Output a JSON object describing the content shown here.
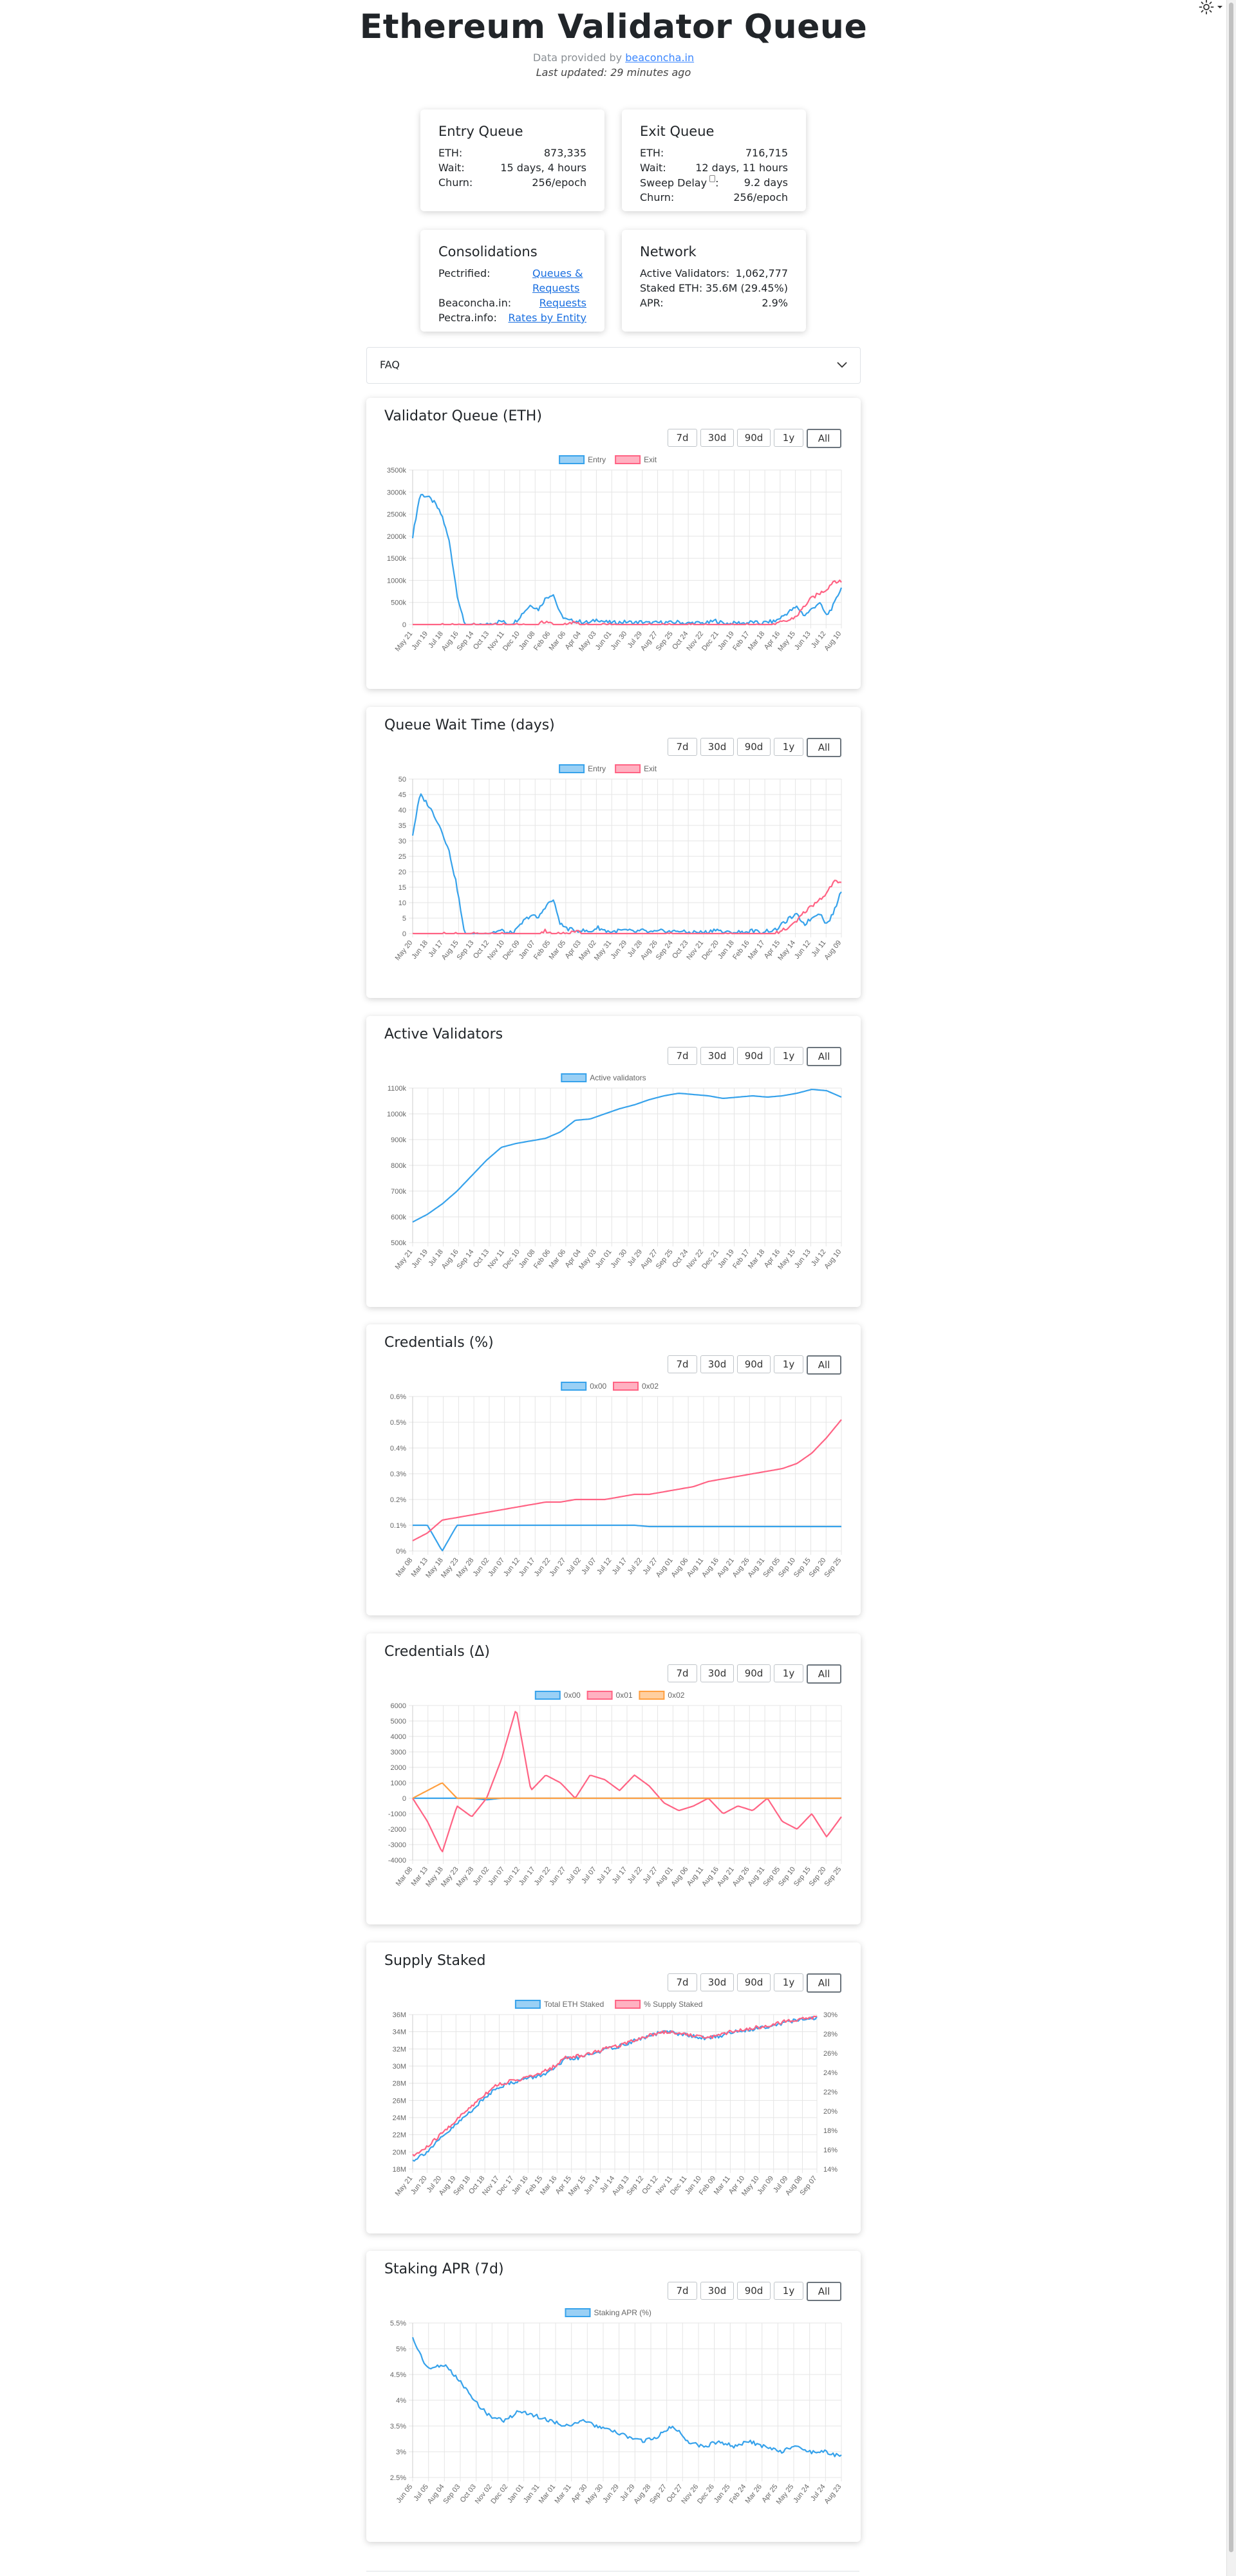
{
  "page": {
    "title": "Ethereum Validator Queue",
    "provided_prefix": "Data provided by",
    "provided_link": "beaconcha.in",
    "last_updated": "Last updated: 29 minutes ago"
  },
  "entry": {
    "title": "Entry Queue",
    "rows": [
      {
        "label": "ETH:",
        "value": "873,335"
      },
      {
        "label": "Wait:",
        "value": "15 days, 4 hours"
      },
      {
        "label": "Churn:",
        "value": "256/epoch"
      }
    ]
  },
  "exit": {
    "title": "Exit Queue",
    "rows": [
      {
        "label": "ETH:",
        "value": "716,715"
      },
      {
        "label": "Wait:",
        "value": "12 days, 11 hours"
      },
      {
        "label": "Sweep Delay",
        "value": "9.2 days"
      },
      {
        "label": "Churn:",
        "value": "256/epoch"
      }
    ]
  },
  "consolidations": {
    "title": "Consolidations",
    "rows": [
      {
        "label": "Pectrified:",
        "link": "Queues & Requests"
      },
      {
        "label": "Beaconcha.in:",
        "link": "Requests"
      },
      {
        "label": "Pectra.info:",
        "link": "Rates by Entity"
      }
    ]
  },
  "network": {
    "title": "Network",
    "rows": [
      {
        "label": "Active Validators:",
        "value": "1,062,777"
      },
      {
        "label": "Staked ETH:",
        "value": "35.6M (29.45%)"
      },
      {
        "label": "APR:",
        "value": "2.9%"
      }
    ]
  },
  "faq": {
    "label": "FAQ"
  },
  "range_buttons": [
    "7d",
    "30d",
    "90d",
    "1y",
    "All"
  ],
  "active_range": "All",
  "colors": {
    "blue": "#36a2eb",
    "red": "#ff6384",
    "orange": "#ff9f40",
    "grid": "#e5e5e5",
    "tick": "#666666"
  },
  "chart_data": [
    {
      "id": "queue-eth",
      "type": "line",
      "title": "Validator Queue (ETH)",
      "x": [
        "May 21",
        "Jun 19",
        "Jul 18",
        "Aug 16",
        "Sep 14",
        "Oct 13",
        "Nov 11",
        "Dec 10",
        "Jan 08",
        "Feb 06",
        "Mar 06",
        "Apr 04",
        "May 03",
        "Jun 01",
        "Jun 30",
        "Jul 29",
        "Aug 27",
        "Sep 25",
        "Oct 24",
        "Nov 22",
        "Dec 21",
        "Jan 19",
        "Feb 17",
        "Mar 18",
        "Apr 16",
        "May 15",
        "Jun 13",
        "Jul 12",
        "Aug 10"
      ],
      "yticks": [
        "3500k",
        "3000k",
        "2500k",
        "2000k",
        "1500k",
        "1000k",
        "500k",
        "0"
      ],
      "ylim": [
        0,
        3500000
      ],
      "series": [
        {
          "name": "Entry",
          "color": "blue",
          "values": [
            2000000,
            2950000,
            2900000,
            2750000,
            2450000,
            1850000,
            700000,
            0,
            0,
            0,
            0,
            40000,
            80000,
            0,
            80000,
            280000,
            450000,
            340000,
            600000,
            700000,
            220000,
            90000,
            80000,
            60000,
            40000,
            120000,
            60000,
            40000,
            50000,
            60000,
            40000,
            60000,
            30000,
            40000,
            50000,
            40000,
            60000,
            20000,
            40000,
            30000,
            40000,
            90000,
            30000,
            20000,
            40000,
            30000,
            60000,
            20000,
            60000,
            70000,
            180000,
            300000,
            400000,
            200000,
            350000,
            500000,
            200000,
            450000,
            850000
          ]
        },
        {
          "name": "Exit",
          "color": "red",
          "values": [
            0,
            0,
            0,
            0,
            0,
            0,
            0,
            0,
            0,
            0,
            0,
            0,
            0,
            0,
            0,
            0,
            0,
            0,
            80000,
            0,
            0,
            0,
            60000,
            0,
            0,
            0,
            0,
            0,
            0,
            0,
            0,
            0,
            0,
            0,
            0,
            0,
            0,
            0,
            0,
            0,
            0,
            0,
            0,
            0,
            0,
            0,
            0,
            0,
            0,
            0,
            50000,
            100000,
            200000,
            420000,
            600000,
            700000,
            800000,
            1000000,
            950000
          ]
        }
      ]
    },
    {
      "id": "wait-days",
      "type": "line",
      "title": "Queue Wait Time (days)",
      "x": [
        "May 20",
        "Jun 18",
        "Jul 17",
        "Aug 15",
        "Sep 13",
        "Oct 12",
        "Nov 10",
        "Dec 09",
        "Jan 07",
        "Feb 05",
        "Mar 05",
        "Apr 03",
        "May 02",
        "May 31",
        "Jun 29",
        "Jul 28",
        "Aug 26",
        "Sep 24",
        "Oct 23",
        "Nov 21",
        "Dec 20",
        "Jan 18",
        "Feb 16",
        "Mar 17",
        "Apr 15",
        "May 14",
        "Jun 12",
        "Jul 11",
        "Aug 09"
      ],
      "yticks": [
        "50",
        "45",
        "40",
        "35",
        "30",
        "25",
        "20",
        "15",
        "10",
        "5",
        "0"
      ],
      "ylim": [
        0,
        50
      ],
      "series": [
        {
          "name": "Entry",
          "color": "blue",
          "values": [
            32,
            45,
            42,
            38,
            33,
            26,
            15,
            0,
            0,
            0,
            0,
            0.5,
            1,
            0,
            1,
            4,
            6,
            5,
            9,
            11,
            3,
            1.5,
            1,
            1,
            0.5,
            2,
            1,
            0.5,
            1,
            1,
            0.5,
            1,
            0.4,
            0.5,
            1,
            0.5,
            1,
            0.3,
            0.5,
            0.4,
            0.5,
            1.5,
            0.4,
            0.3,
            0.5,
            0.4,
            1,
            0.3,
            1,
            1,
            3,
            5,
            6,
            3,
            5,
            7,
            3,
            7,
            14
          ]
        },
        {
          "name": "Exit",
          "color": "red",
          "values": [
            0,
            0,
            0,
            0,
            0,
            0,
            0,
            0,
            0,
            0,
            0,
            0,
            0,
            0,
            0,
            0,
            0,
            0,
            1,
            0,
            0,
            0,
            1,
            0,
            0,
            0,
            0,
            0,
            0,
            0,
            0,
            0,
            0,
            0,
            0,
            0,
            0,
            0,
            0,
            0,
            0,
            0,
            0,
            0,
            0,
            0,
            0,
            0,
            0,
            0,
            1,
            2,
            4,
            7,
            9,
            11,
            13,
            17,
            16
          ]
        }
      ]
    },
    {
      "id": "active-validators",
      "type": "line",
      "title": "Active Validators",
      "x": [
        "May 21",
        "Jun 19",
        "Jul 18",
        "Aug 16",
        "Sep 14",
        "Oct 13",
        "Nov 11",
        "Dec 10",
        "Jan 08",
        "Feb 06",
        "Mar 06",
        "Apr 04",
        "May 03",
        "Jun 01",
        "Jun 30",
        "Jul 29",
        "Aug 27",
        "Sep 25",
        "Oct 24",
        "Nov 22",
        "Dec 21",
        "Jan 19",
        "Feb 17",
        "Mar 18",
        "Apr 16",
        "May 15",
        "Jun 13",
        "Jul 12",
        "Aug 10"
      ],
      "yticks": [
        "1100k",
        "1000k",
        "900k",
        "800k",
        "700k",
        "600k",
        "500k"
      ],
      "ylim": [
        500000,
        1100000
      ],
      "series": [
        {
          "name": "Active validators",
          "color": "blue",
          "values": [
            580000,
            610000,
            650000,
            700000,
            760000,
            820000,
            870000,
            885000,
            895000,
            905000,
            930000,
            975000,
            980000,
            1000000,
            1020000,
            1035000,
            1055000,
            1070000,
            1080000,
            1075000,
            1070000,
            1060000,
            1065000,
            1070000,
            1065000,
            1070000,
            1080000,
            1095000,
            1090000,
            1065000
          ]
        }
      ]
    },
    {
      "id": "credentials-pct",
      "type": "line",
      "title": "Credentials (%)",
      "x": [
        "Mar 08",
        "Mar 13",
        "May 18",
        "May 23",
        "May 28",
        "Jun 02",
        "Jun 07",
        "Jun 12",
        "Jun 17",
        "Jun 22",
        "Jun 27",
        "Jul 02",
        "Jul 07",
        "Jul 12",
        "Jul 17",
        "Jul 22",
        "Jul 27",
        "Aug 01",
        "Aug 06",
        "Aug 11",
        "Aug 16",
        "Aug 21",
        "Aug 26",
        "Aug 31",
        "Sep 05",
        "Sep 10",
        "Sep 15",
        "Sep 20",
        "Sep 25"
      ],
      "yticks": [
        "0.6%",
        "0.5%",
        "0.4%",
        "0.3%",
        "0.2%",
        "0.1%",
        "0%"
      ],
      "ylim": [
        0,
        0.6
      ],
      "series": [
        {
          "name": "0x00",
          "color": "blue",
          "values": [
            0.1,
            0.1,
            0.0,
            0.1,
            0.1,
            0.1,
            0.1,
            0.1,
            0.1,
            0.1,
            0.1,
            0.1,
            0.1,
            0.1,
            0.1,
            0.1,
            0.095,
            0.095,
            0.095,
            0.095,
            0.095,
            0.095,
            0.095,
            0.095,
            0.095,
            0.095,
            0.095,
            0.095,
            0.095,
            0.095
          ]
        },
        {
          "name": "0x02",
          "color": "red",
          "values": [
            0.04,
            0.07,
            0.12,
            0.13,
            0.14,
            0.15,
            0.16,
            0.17,
            0.18,
            0.19,
            0.19,
            0.2,
            0.2,
            0.2,
            0.21,
            0.22,
            0.22,
            0.23,
            0.24,
            0.25,
            0.27,
            0.28,
            0.29,
            0.3,
            0.31,
            0.32,
            0.34,
            0.38,
            0.44,
            0.51
          ]
        }
      ]
    },
    {
      "id": "credentials-delta",
      "type": "line",
      "title": "Credentials (Δ)",
      "x": [
        "Mar 08",
        "Mar 13",
        "May 18",
        "May 23",
        "May 28",
        "Jun 02",
        "Jun 07",
        "Jun 12",
        "Jun 17",
        "Jun 22",
        "Jun 27",
        "Jul 02",
        "Jul 07",
        "Jul 12",
        "Jul 17",
        "Jul 22",
        "Jul 27",
        "Aug 01",
        "Aug 06",
        "Aug 11",
        "Aug 16",
        "Aug 21",
        "Aug 26",
        "Aug 31",
        "Sep 05",
        "Sep 10",
        "Sep 15",
        "Sep 20",
        "Sep 25"
      ],
      "yticks": [
        "6000",
        "5000",
        "4000",
        "3000",
        "2000",
        "1000",
        "0",
        "-1000",
        "-2000",
        "-3000",
        "-4000"
      ],
      "ylim": [
        -4000,
        6000
      ],
      "series": [
        {
          "name": "0x00",
          "color": "blue",
          "values": [
            0,
            0,
            0,
            0,
            0,
            -100,
            0,
            0,
            0,
            0,
            0,
            0,
            0,
            0,
            0,
            0,
            0,
            0,
            0,
            0,
            0,
            0,
            0,
            0,
            0,
            0,
            0,
            0,
            0,
            0
          ]
        },
        {
          "name": "0x01",
          "color": "red",
          "values": [
            0,
            -1500,
            -3500,
            -500,
            -1200,
            0,
            2500,
            5800,
            500,
            1500,
            1000,
            0,
            1500,
            1200,
            500,
            1500,
            800,
            -300,
            -800,
            -500,
            0,
            -1000,
            -500,
            -800,
            0,
            -1500,
            -2000,
            -1000,
            -2500,
            -1200
          ]
        },
        {
          "name": "0x02",
          "color": "orange",
          "values": [
            0,
            500,
            1000,
            0,
            0,
            0,
            0,
            0,
            0,
            0,
            0,
            0,
            0,
            0,
            0,
            0,
            0,
            0,
            0,
            0,
            0,
            0,
            0,
            0,
            0,
            0,
            0,
            0,
            0,
            0
          ]
        }
      ]
    },
    {
      "id": "supply-staked",
      "type": "line",
      "title": "Supply Staked",
      "x": [
        "May 21",
        "Jun 20",
        "Jul 20",
        "Aug 19",
        "Sep 18",
        "Oct 18",
        "Nov 17",
        "Dec 17",
        "Jan 16",
        "Feb 15",
        "Mar 16",
        "Apr 15",
        "May 15",
        "Jun 14",
        "Jul 14",
        "Aug 13",
        "Sep 12",
        "Oct 12",
        "Nov 11",
        "Dec 11",
        "Jan 10",
        "Feb 09",
        "Mar 11",
        "Apr 10",
        "May 10",
        "Jun 09",
        "Jul 09",
        "Aug 08",
        "Sep 07"
      ],
      "yticks": [
        "36M",
        "34M",
        "32M",
        "30M",
        "28M",
        "26M",
        "24M",
        "22M",
        "20M",
        "18M"
      ],
      "yticks_right": [
        "30%",
        "28%",
        "26%",
        "24%",
        "22%",
        "20%",
        "18%",
        "16%",
        "14%"
      ],
      "ylim": [
        18000000,
        36000000
      ],
      "series": [
        {
          "name": "Total ETH Staked",
          "color": "blue",
          "values": [
            19000000,
            20000000,
            21500000,
            23000000,
            24500000,
            26000000,
            27500000,
            28000000,
            28500000,
            28800000,
            29500000,
            30800000,
            31000000,
            31500000,
            32000000,
            32400000,
            33000000,
            33500000,
            34000000,
            33800000,
            33500000,
            33200000,
            33500000,
            34000000,
            34200000,
            34500000,
            34800000,
            35200000,
            35400000,
            35600000
          ]
        },
        {
          "name": "% Supply Staked",
          "color": "red",
          "values": [
            19500000,
            20500000,
            22000000,
            23500000,
            25000000,
            26500000,
            27800000,
            28200000,
            28600000,
            29000000,
            29800000,
            31000000,
            31200000,
            31600000,
            32100000,
            32500000,
            33100000,
            33600000,
            34000000,
            33900000,
            33600000,
            33300000,
            33600000,
            34100000,
            34300000,
            34600000,
            34900000,
            35300000,
            35500000,
            35700000
          ]
        }
      ]
    },
    {
      "id": "staking-apr",
      "type": "line",
      "title": "Staking APR (7d)",
      "x": [
        "Jun 05",
        "Jul 05",
        "Aug 04",
        "Sep 03",
        "Oct 03",
        "Nov 02",
        "Dec 02",
        "Jan 01",
        "Jan 31",
        "Mar 01",
        "Mar 31",
        "Apr 30",
        "May 30",
        "Jun 29",
        "Jul 29",
        "Aug 28",
        "Sep 27",
        "Oct 27",
        "Nov 26",
        "Dec 26",
        "Jan 25",
        "Feb 24",
        "Mar 26",
        "Apr 25",
        "May 25",
        "Jun 24",
        "Jul 24",
        "Aug 23"
      ],
      "yticks": [
        "5.5%",
        "5%",
        "4.5%",
        "4%",
        "3.5%",
        "3%",
        "2.5%"
      ],
      "ylim": [
        2.5,
        5.5
      ],
      "series": [
        {
          "name": "Staking APR (%)",
          "color": "blue",
          "values": [
            5.2,
            4.6,
            4.7,
            4.4,
            4.0,
            3.7,
            3.6,
            3.8,
            3.7,
            3.6,
            3.5,
            3.6,
            3.5,
            3.4,
            3.3,
            3.2,
            3.3,
            3.5,
            3.2,
            3.1,
            3.2,
            3.1,
            3.2,
            3.1,
            3.0,
            3.1,
            3.0,
            3.0,
            2.9
          ]
        }
      ]
    }
  ]
}
